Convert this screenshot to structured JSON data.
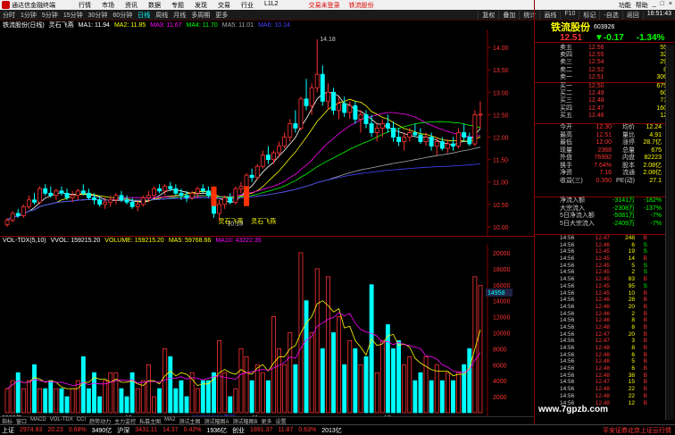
{
  "window": {
    "title": "通达信金融终端",
    "menus": [
      "行情",
      "市场",
      "资讯",
      "数据",
      "专题",
      "发现",
      "交易",
      "行业",
      "L1L2"
    ],
    "promo1": "交易未登录",
    "promo2": "铁流股份",
    "right": [
      "功能",
      "帮助"
    ]
  },
  "toolbar": {
    "periods": [
      "分时",
      "1分钟",
      "5分钟",
      "15分钟",
      "30分钟",
      "60分钟",
      "日线",
      "周线",
      "月线",
      "多周期",
      "更多"
    ],
    "active": "日线",
    "right": [
      "复权",
      "叠加",
      "统计",
      "画线",
      "F10",
      "标记",
      "-自选",
      "返回"
    ],
    "clock": "16:51:43"
  },
  "kline_bar": {
    "name": "铁流股份(日线)",
    "ind": "灵石飞燕",
    "ma1": "MA1: 11.94",
    "ma2": "MA2: 11.85",
    "ma3": "MA3: 11.67",
    "ma4": "MA4: 11.70",
    "ma5": "MA5: 11.01",
    "ma6": "MA6: 10.14"
  },
  "kline_labels": {
    "high": "14.18",
    "low_label": "灵石飞燕",
    "low2": "10.13",
    "low_label2": "灵石飞燕"
  },
  "price_axis": [
    "14.00",
    "13.50",
    "13.00",
    "12.50",
    "12.00",
    "11.50",
    "11.00",
    "10.50",
    "10.00"
  ],
  "vol_bar": {
    "name": "VOL-TDX(5,10)",
    "vvol": "VVOL: 159215.20",
    "volume": "VOLUME: 159215.20",
    "ma5": "MA5: 59768.66",
    "ma10": "MA10: 43222.35"
  },
  "vol_axis": [
    "20000",
    "18000",
    "16000",
    "14000",
    "12000",
    "10000",
    "8000",
    "6000",
    "4000",
    "2000"
  ],
  "vol_marker": "14958",
  "date_labels": [
    "2023年",
    "10",
    "2023/10/19周四",
    "11",
    "12"
  ],
  "subtabs": [
    "指标",
    "窗口",
    "MACD",
    "VOL-TDX",
    "CCI",
    "趋势动力",
    "主力监控",
    "私募主图",
    "MA2",
    "测试主图",
    "测试幅图A",
    "测试幅图B",
    "更多",
    "设置"
  ],
  "stock": {
    "name": "铁流股份",
    "code": "603926",
    "price": "12.51",
    "change": "▼-0.17",
    "pct": "-1.34%"
  },
  "quotes": {
    "asks": [
      {
        "l": "卖五",
        "p": "12.56",
        "v": "55"
      },
      {
        "l": "卖四",
        "p": "12.55",
        "v": "32"
      },
      {
        "l": "卖三",
        "p": "12.54",
        "v": "29"
      },
      {
        "l": "卖二",
        "p": "12.52",
        "v": "8"
      },
      {
        "l": "卖一",
        "p": "12.51",
        "v": "306"
      }
    ],
    "bids": [
      {
        "l": "买一",
        "p": "12.50",
        "v": "675"
      },
      {
        "l": "买二",
        "p": "12.49",
        "v": "60"
      },
      {
        "l": "买三",
        "p": "12.48",
        "v": "71"
      },
      {
        "l": "买四",
        "p": "12.47",
        "v": "160"
      },
      {
        "l": "买五",
        "p": "12.46",
        "v": "12"
      }
    ]
  },
  "stats": [
    {
      "a": "今开",
      "av": "12.30",
      "b": "均价",
      "bv": "12.24"
    },
    {
      "a": "最高",
      "av": "12.51",
      "b": "量比",
      "bv": "4.91"
    },
    {
      "a": "最低",
      "av": "12.00",
      "b": "涨停",
      "bv": "28.7亿"
    },
    {
      "a": "现量",
      "av": "2368",
      "b": "总量",
      "bv": "675"
    },
    {
      "a": "外盘",
      "av": "76992",
      "b": "内盘",
      "bv": "82223"
    },
    {
      "a": "换手",
      "av": "7.64%",
      "b": "股本",
      "bv": "2.08亿"
    },
    {
      "a": "净资",
      "av": "7.16",
      "b": "流通",
      "bv": "2.08亿"
    },
    {
      "a": "收益(三)",
      "av": "0.350",
      "b": "PE(动)",
      "bv": "27.1"
    }
  ],
  "flows": [
    {
      "l": "净流入额",
      "v": "-3141万",
      "r": "-182%"
    },
    {
      "l": "大宗流入",
      "v": "-2308万",
      "r": "-137%"
    },
    {
      "l": "5日净流入额",
      "v": "-5081万",
      "r": "-7%"
    },
    {
      "l": "5日大宗流入",
      "v": "-2409万",
      "r": "-7%"
    }
  ],
  "ticks": [
    {
      "t": "14:56",
      "p": "12.47",
      "v": "248",
      "s": "B"
    },
    {
      "t": "14:56",
      "p": "12.46",
      "v": "6",
      "s": "S"
    },
    {
      "t": "14:56",
      "p": "12.45",
      "v": "19",
      "s": "S"
    },
    {
      "t": "14:56",
      "p": "12.45",
      "v": "14",
      "s": "B"
    },
    {
      "t": "14:56",
      "p": "12.45",
      "v": "5",
      "s": "S"
    },
    {
      "t": "14:56",
      "p": "12.45",
      "v": "2",
      "s": "S"
    },
    {
      "t": "14:56",
      "p": "12.45",
      "v": "83",
      "s": "B"
    },
    {
      "t": "14:56",
      "p": "12.45",
      "v": "95",
      "s": "S"
    },
    {
      "t": "14:56",
      "p": "12.45",
      "v": "10",
      "s": "B"
    },
    {
      "t": "14:56",
      "p": "12.46",
      "v": "28",
      "s": "B"
    },
    {
      "t": "14:56",
      "p": "12.46",
      "v": "20",
      "s": "B"
    },
    {
      "t": "14:56",
      "p": "12.46",
      "v": "2",
      "s": "B"
    },
    {
      "t": "14:56",
      "p": "12.46",
      "v": "8",
      "s": "B"
    },
    {
      "t": "14:56",
      "p": "12.48",
      "v": "8",
      "s": "B"
    },
    {
      "t": "14:56",
      "p": "12.47",
      "v": "20",
      "s": "B"
    },
    {
      "t": "14:56",
      "p": "12.47",
      "v": "3",
      "s": "B"
    },
    {
      "t": "14:56",
      "p": "12.48",
      "v": "8",
      "s": "B"
    },
    {
      "t": "14:56",
      "p": "12.48",
      "v": "6",
      "s": "B"
    },
    {
      "t": "14:56",
      "p": "12.48",
      "v": "5",
      "s": "B"
    },
    {
      "t": "14:56",
      "p": "12.48",
      "v": "6",
      "s": "B"
    },
    {
      "t": "14:56",
      "p": "12.48",
      "v": "38",
      "s": "B"
    },
    {
      "t": "14:56",
      "p": "12.47",
      "v": "15",
      "s": "B"
    },
    {
      "t": "14:56",
      "p": "12.48",
      "v": "22",
      "s": "B"
    },
    {
      "t": "14:56",
      "p": "12.48",
      "v": "22",
      "s": "B"
    },
    {
      "t": "14:56",
      "p": "12.48",
      "v": "12",
      "s": "B"
    }
  ],
  "status": {
    "items": [
      {
        "k": "上证",
        "v": "2974.93",
        "c": "20.23",
        "p": "0.68%",
        "amt": "3490亿"
      },
      {
        "k": "沪深",
        "v": "3431.11",
        "c": "14.37",
        "p": "0.42%",
        "amt": "1936亿"
      },
      {
        "k": "创业",
        "v": "1891.37",
        "c": "11.87",
        "p": "0.63%",
        "amt": "2013亿"
      }
    ],
    "right": "平安证券北京上证云行情"
  },
  "watermark": "www.7gpzb.com",
  "chart_data": {
    "type": "candlestick",
    "price_range": [
      9.8,
      14.4
    ],
    "candles": [
      [
        10.05,
        10.2,
        10.0,
        10.15
      ],
      [
        10.15,
        10.35,
        10.1,
        10.3
      ],
      [
        10.3,
        10.4,
        10.2,
        10.25
      ],
      [
        10.25,
        10.5,
        10.2,
        10.45
      ],
      [
        10.45,
        10.7,
        10.4,
        10.6
      ],
      [
        10.6,
        10.75,
        10.5,
        10.55
      ],
      [
        10.55,
        10.9,
        10.5,
        10.85
      ],
      [
        10.85,
        10.95,
        10.7,
        10.75
      ],
      [
        10.75,
        10.9,
        10.65,
        10.7
      ],
      [
        10.7,
        10.85,
        10.6,
        10.8
      ],
      [
        10.8,
        10.9,
        10.7,
        10.75
      ],
      [
        10.75,
        10.85,
        10.6,
        10.65
      ],
      [
        10.65,
        10.8,
        10.55,
        10.7
      ],
      [
        10.7,
        10.85,
        10.6,
        10.8
      ],
      [
        10.8,
        10.95,
        10.7,
        10.75
      ],
      [
        10.75,
        10.85,
        10.6,
        10.65
      ],
      [
        10.65,
        10.75,
        10.5,
        10.6
      ],
      [
        10.6,
        10.7,
        10.45,
        10.5
      ],
      [
        10.5,
        10.65,
        10.4,
        10.55
      ],
      [
        10.55,
        10.7,
        10.45,
        10.6
      ],
      [
        10.6,
        10.75,
        10.5,
        10.7
      ],
      [
        10.7,
        10.8,
        10.55,
        10.6
      ],
      [
        10.6,
        10.7,
        10.5,
        10.55
      ],
      [
        10.55,
        10.65,
        10.4,
        10.45
      ],
      [
        10.45,
        10.6,
        10.35,
        10.5
      ],
      [
        10.5,
        10.7,
        10.45,
        10.65
      ],
      [
        10.65,
        10.8,
        10.55,
        10.7
      ],
      [
        10.7,
        10.9,
        10.65,
        10.85
      ],
      [
        10.85,
        10.95,
        10.75,
        10.8
      ],
      [
        10.8,
        10.95,
        10.7,
        10.9
      ],
      [
        10.9,
        11.0,
        10.8,
        10.85
      ],
      [
        10.85,
        10.95,
        10.7,
        10.75
      ],
      [
        10.75,
        10.85,
        10.6,
        10.7
      ],
      [
        10.7,
        10.8,
        10.55,
        10.65
      ],
      [
        10.65,
        10.8,
        10.6,
        10.75
      ],
      [
        10.75,
        10.9,
        10.65,
        10.85
      ],
      [
        10.85,
        10.95,
        10.75,
        10.8
      ],
      [
        10.8,
        10.9,
        10.65,
        10.7
      ],
      [
        10.7,
        10.8,
        10.2,
        10.3
      ],
      [
        10.3,
        10.6,
        10.13,
        10.5
      ],
      [
        10.5,
        10.7,
        10.4,
        10.65
      ],
      [
        10.65,
        10.75,
        10.5,
        10.55
      ],
      [
        10.55,
        10.9,
        10.5,
        10.85
      ],
      [
        10.85,
        11.0,
        10.75,
        10.9
      ],
      [
        10.9,
        11.2,
        10.85,
        11.15
      ],
      [
        11.15,
        11.3,
        11.0,
        11.1
      ],
      [
        11.1,
        11.4,
        11.05,
        11.35
      ],
      [
        11.35,
        11.7,
        11.3,
        11.6
      ],
      [
        11.6,
        11.8,
        11.4,
        11.5
      ],
      [
        11.5,
        11.7,
        11.4,
        11.65
      ],
      [
        11.65,
        11.9,
        11.55,
        11.8
      ],
      [
        11.8,
        12.1,
        11.75,
        12.0
      ],
      [
        12.0,
        12.4,
        11.9,
        12.3
      ],
      [
        12.3,
        12.6,
        12.1,
        12.2
      ],
      [
        12.2,
        12.9,
        12.15,
        12.85
      ],
      [
        12.85,
        13.3,
        12.6,
        12.7
      ],
      [
        12.7,
        13.2,
        12.5,
        13.1
      ],
      [
        13.1,
        14.18,
        13.0,
        13.4
      ],
      [
        13.4,
        13.6,
        12.7,
        12.8
      ],
      [
        12.8,
        13.2,
        12.6,
        13.0
      ],
      [
        13.0,
        13.1,
        12.5,
        12.6
      ],
      [
        12.6,
        12.9,
        12.4,
        12.75
      ],
      [
        12.75,
        12.9,
        12.45,
        12.55
      ],
      [
        12.55,
        12.8,
        12.4,
        12.7
      ],
      [
        12.7,
        12.8,
        12.3,
        12.4
      ],
      [
        12.4,
        12.6,
        12.1,
        12.5
      ],
      [
        12.5,
        12.6,
        12.2,
        12.3
      ],
      [
        12.3,
        12.5,
        12.0,
        12.1
      ],
      [
        12.1,
        12.3,
        11.9,
        12.2
      ],
      [
        12.2,
        12.4,
        12.0,
        12.3
      ],
      [
        12.3,
        12.5,
        12.1,
        12.2
      ],
      [
        12.2,
        12.35,
        11.9,
        12.0
      ],
      [
        12.0,
        12.2,
        11.8,
        11.9
      ],
      [
        11.9,
        12.1,
        11.7,
        12.0
      ],
      [
        12.0,
        12.2,
        11.9,
        12.1
      ],
      [
        12.1,
        12.3,
        12.0,
        12.05
      ],
      [
        12.05,
        12.2,
        11.85,
        11.9
      ],
      [
        11.9,
        12.1,
        11.8,
        12.0
      ],
      [
        12.0,
        12.1,
        11.7,
        11.8
      ],
      [
        11.8,
        12.0,
        11.6,
        11.9
      ],
      [
        11.9,
        12.0,
        11.7,
        11.75
      ],
      [
        11.75,
        11.95,
        11.65,
        11.85
      ],
      [
        11.85,
        12.0,
        11.7,
        11.8
      ],
      [
        11.8,
        12.2,
        11.75,
        12.1
      ],
      [
        12.1,
        12.3,
        11.9,
        12.0
      ],
      [
        12.0,
        12.1,
        11.8,
        11.85
      ],
      [
        11.85,
        12.6,
        11.8,
        12.5
      ],
      [
        12.5,
        12.8,
        12.2,
        12.51
      ]
    ],
    "volumes": [
      3,
      4,
      5,
      3,
      4,
      6,
      3,
      3,
      4,
      3,
      3,
      2,
      3,
      4,
      7,
      3,
      5,
      2,
      4,
      5,
      5,
      3,
      2,
      5,
      3,
      4,
      6,
      2,
      3,
      8,
      7,
      3,
      4,
      2,
      5,
      3,
      4,
      4,
      5,
      9,
      5,
      2,
      3,
      8,
      7,
      4,
      6,
      5,
      4,
      12,
      8,
      6,
      10,
      6,
      20,
      14,
      10,
      18,
      8,
      17,
      10,
      12,
      6,
      9,
      8,
      6,
      7,
      16,
      5,
      9,
      11,
      8,
      9,
      6,
      7,
      4,
      5,
      7,
      4,
      6,
      4,
      5,
      4,
      5,
      6,
      8,
      17,
      15.9
    ]
  }
}
